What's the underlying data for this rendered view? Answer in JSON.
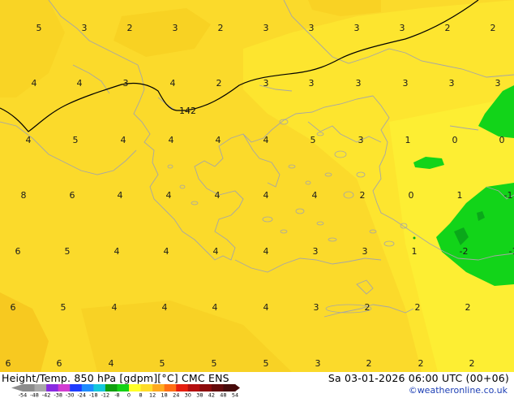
{
  "header": {
    "title": "Height/Temp. 850 hPa [gdpm][°C] CMC ENS",
    "datetime": "Sa 03-01-2026 06:00 UTC (00+06)",
    "credit": "©weatheronline.co.uk"
  },
  "colors": {
    "sea_land_base": "#fbda2b",
    "light_yellow": "#fdec30",
    "orange_yellow": "#f6c21c",
    "green": "#10d618",
    "dark_green": "#0aa81a",
    "coastline": "#a9a9a9",
    "contour": "#000000"
  },
  "map": {
    "region": "Greece / Aegean Sea",
    "contour_label": "142",
    "temperature_labels": [
      "5",
      "3",
      "2",
      "3",
      "2",
      "3",
      "3",
      "3",
      "3",
      "2",
      "2",
      "4",
      "4",
      "3",
      "4",
      "2",
      "3",
      "3",
      "3",
      "3",
      "3",
      "3",
      "4",
      "5",
      "4",
      "4",
      "4",
      "4",
      "5",
      "3",
      "1",
      "0",
      "0",
      "8",
      "6",
      "4",
      "4",
      "4",
      "4",
      "4",
      "2",
      "0",
      "1",
      "-1",
      "6",
      "5",
      "4",
      "4",
      "4",
      "4",
      "3",
      "3",
      "1",
      "-2",
      "-1",
      "6",
      "5",
      "4",
      "4",
      "4",
      "4",
      "3",
      "2",
      "2",
      "2",
      "6",
      "6",
      "4",
      "5",
      "5",
      "5",
      "3",
      "2",
      "2",
      "2"
    ]
  },
  "colorbar": {
    "tick_labels": [
      "-54",
      "-48",
      "-42",
      "-38",
      "-30",
      "-24",
      "-18",
      "-12",
      "-8",
      "0",
      "8",
      "12",
      "18",
      "24",
      "30",
      "38",
      "42",
      "48",
      "54"
    ],
    "colors": [
      "#8c8c8c",
      "#a9a9a9",
      "#8a2be2",
      "#d23cd2",
      "#1e3cff",
      "#1e8cff",
      "#14c8dc",
      "#0fa00f",
      "#14d214",
      "#ffff28",
      "#ffdc28",
      "#ffaa1e",
      "#ff6e14",
      "#e61e0f",
      "#b40f0f",
      "#8c0a0a",
      "#640a0a",
      "#460a0a"
    ]
  }
}
